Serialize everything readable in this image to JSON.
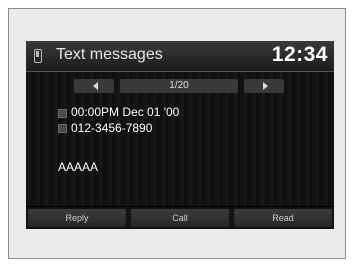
{
  "header": {
    "title": "Text messages",
    "clock": "12:34",
    "icon": "phone-icon"
  },
  "pager": {
    "indicator": "1/20",
    "prev_icon": "arrow-left-icon",
    "next_icon": "arrow-right-icon"
  },
  "message": {
    "datetime": "00:00PM Dec 01 '00",
    "sender": "012-3456-7890",
    "body": "AAAAA"
  },
  "actions": {
    "reply_label": "Reply",
    "call_label": "Call",
    "read_label": "Read"
  },
  "colors": {
    "screen_bg": "#000000",
    "header_bg": "#2a2a2a",
    "button_bg": "#303030",
    "text": "#ffffff"
  }
}
